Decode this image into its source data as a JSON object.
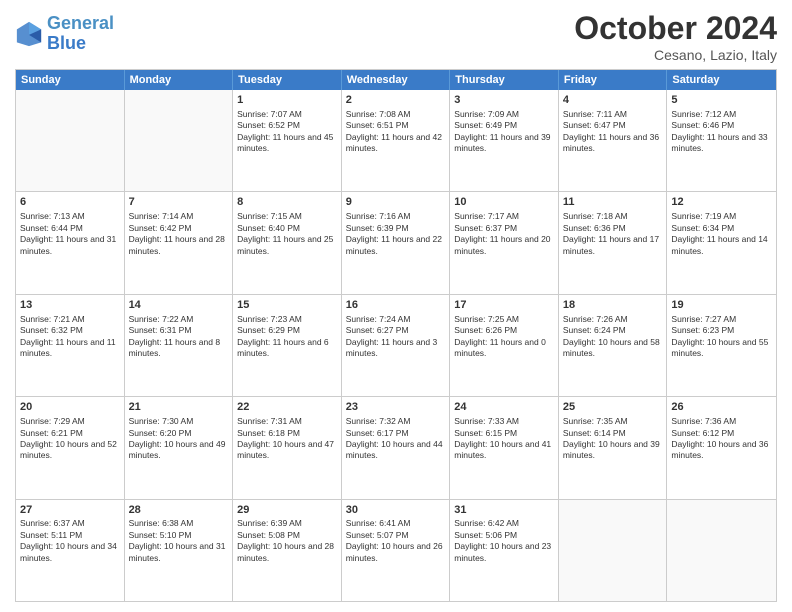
{
  "header": {
    "logo_line1": "General",
    "logo_line2": "Blue",
    "month": "October 2024",
    "location": "Cesano, Lazio, Italy"
  },
  "weekdays": [
    "Sunday",
    "Monday",
    "Tuesday",
    "Wednesday",
    "Thursday",
    "Friday",
    "Saturday"
  ],
  "rows": [
    [
      {
        "day": "",
        "info": "",
        "empty": true
      },
      {
        "day": "",
        "info": "",
        "empty": true
      },
      {
        "day": "1",
        "info": "Sunrise: 7:07 AM\nSunset: 6:52 PM\nDaylight: 11 hours and 45 minutes."
      },
      {
        "day": "2",
        "info": "Sunrise: 7:08 AM\nSunset: 6:51 PM\nDaylight: 11 hours and 42 minutes."
      },
      {
        "day": "3",
        "info": "Sunrise: 7:09 AM\nSunset: 6:49 PM\nDaylight: 11 hours and 39 minutes."
      },
      {
        "day": "4",
        "info": "Sunrise: 7:11 AM\nSunset: 6:47 PM\nDaylight: 11 hours and 36 minutes."
      },
      {
        "day": "5",
        "info": "Sunrise: 7:12 AM\nSunset: 6:46 PM\nDaylight: 11 hours and 33 minutes."
      }
    ],
    [
      {
        "day": "6",
        "info": "Sunrise: 7:13 AM\nSunset: 6:44 PM\nDaylight: 11 hours and 31 minutes."
      },
      {
        "day": "7",
        "info": "Sunrise: 7:14 AM\nSunset: 6:42 PM\nDaylight: 11 hours and 28 minutes."
      },
      {
        "day": "8",
        "info": "Sunrise: 7:15 AM\nSunset: 6:40 PM\nDaylight: 11 hours and 25 minutes."
      },
      {
        "day": "9",
        "info": "Sunrise: 7:16 AM\nSunset: 6:39 PM\nDaylight: 11 hours and 22 minutes."
      },
      {
        "day": "10",
        "info": "Sunrise: 7:17 AM\nSunset: 6:37 PM\nDaylight: 11 hours and 20 minutes."
      },
      {
        "day": "11",
        "info": "Sunrise: 7:18 AM\nSunset: 6:36 PM\nDaylight: 11 hours and 17 minutes."
      },
      {
        "day": "12",
        "info": "Sunrise: 7:19 AM\nSunset: 6:34 PM\nDaylight: 11 hours and 14 minutes."
      }
    ],
    [
      {
        "day": "13",
        "info": "Sunrise: 7:21 AM\nSunset: 6:32 PM\nDaylight: 11 hours and 11 minutes."
      },
      {
        "day": "14",
        "info": "Sunrise: 7:22 AM\nSunset: 6:31 PM\nDaylight: 11 hours and 8 minutes."
      },
      {
        "day": "15",
        "info": "Sunrise: 7:23 AM\nSunset: 6:29 PM\nDaylight: 11 hours and 6 minutes."
      },
      {
        "day": "16",
        "info": "Sunrise: 7:24 AM\nSunset: 6:27 PM\nDaylight: 11 hours and 3 minutes."
      },
      {
        "day": "17",
        "info": "Sunrise: 7:25 AM\nSunset: 6:26 PM\nDaylight: 11 hours and 0 minutes."
      },
      {
        "day": "18",
        "info": "Sunrise: 7:26 AM\nSunset: 6:24 PM\nDaylight: 10 hours and 58 minutes."
      },
      {
        "day": "19",
        "info": "Sunrise: 7:27 AM\nSunset: 6:23 PM\nDaylight: 10 hours and 55 minutes."
      }
    ],
    [
      {
        "day": "20",
        "info": "Sunrise: 7:29 AM\nSunset: 6:21 PM\nDaylight: 10 hours and 52 minutes."
      },
      {
        "day": "21",
        "info": "Sunrise: 7:30 AM\nSunset: 6:20 PM\nDaylight: 10 hours and 49 minutes."
      },
      {
        "day": "22",
        "info": "Sunrise: 7:31 AM\nSunset: 6:18 PM\nDaylight: 10 hours and 47 minutes."
      },
      {
        "day": "23",
        "info": "Sunrise: 7:32 AM\nSunset: 6:17 PM\nDaylight: 10 hours and 44 minutes."
      },
      {
        "day": "24",
        "info": "Sunrise: 7:33 AM\nSunset: 6:15 PM\nDaylight: 10 hours and 41 minutes."
      },
      {
        "day": "25",
        "info": "Sunrise: 7:35 AM\nSunset: 6:14 PM\nDaylight: 10 hours and 39 minutes."
      },
      {
        "day": "26",
        "info": "Sunrise: 7:36 AM\nSunset: 6:12 PM\nDaylight: 10 hours and 36 minutes."
      }
    ],
    [
      {
        "day": "27",
        "info": "Sunrise: 6:37 AM\nSunset: 5:11 PM\nDaylight: 10 hours and 34 minutes."
      },
      {
        "day": "28",
        "info": "Sunrise: 6:38 AM\nSunset: 5:10 PM\nDaylight: 10 hours and 31 minutes."
      },
      {
        "day": "29",
        "info": "Sunrise: 6:39 AM\nSunset: 5:08 PM\nDaylight: 10 hours and 28 minutes."
      },
      {
        "day": "30",
        "info": "Sunrise: 6:41 AM\nSunset: 5:07 PM\nDaylight: 10 hours and 26 minutes."
      },
      {
        "day": "31",
        "info": "Sunrise: 6:42 AM\nSunset: 5:06 PM\nDaylight: 10 hours and 23 minutes."
      },
      {
        "day": "",
        "info": "",
        "empty": true
      },
      {
        "day": "",
        "info": "",
        "empty": true
      }
    ]
  ]
}
